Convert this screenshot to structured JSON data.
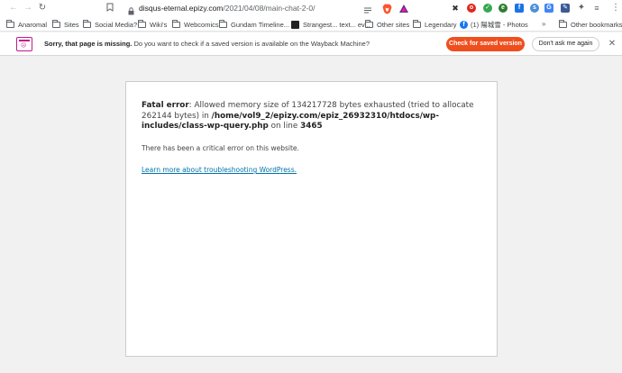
{
  "browser": {
    "url_host": "disqus-eternal.epizy.com",
    "url_path": "/2021/04/08/main-chat-2-0/",
    "icons": {
      "back": "back-arrow-icon",
      "forward": "forward-arrow-icon",
      "reload": "reload-icon",
      "bookmark": "bookmark-icon",
      "lock": "lock-icon",
      "reader": "reader-mode-icon",
      "brave": "brave-shields-icon",
      "rewards": "brave-rewards-icon",
      "menu": "kebab-menu-icon"
    }
  },
  "bookmarks": {
    "items": [
      {
        "label": "Anaromal",
        "type": "folder"
      },
      {
        "label": "Sites",
        "type": "folder"
      },
      {
        "label": "Social Media?",
        "type": "folder"
      },
      {
        "label": "Wiki's",
        "type": "folder"
      },
      {
        "label": "Webcomics",
        "type": "folder"
      },
      {
        "label": "Gundam Timeline...",
        "type": "folder"
      },
      {
        "label": "Strangest... text... ev...",
        "type": "page"
      },
      {
        "label": "Other sites",
        "type": "folder"
      },
      {
        "label": "Legendary",
        "type": "folder"
      },
      {
        "label": "(1) 陽城雪 - Photos",
        "type": "page"
      }
    ],
    "overflow": "»",
    "other": "Other bookmarks"
  },
  "infobar": {
    "title": "Sorry, that page is missing.",
    "message": "Do you want to check if a saved version is available on the Wayback Machine?",
    "check_button": "Check for saved version",
    "dont_button": "Don't ask me again",
    "close": "✕"
  },
  "error": {
    "label": "Fatal error",
    "text": ": Allowed memory size of 134217728 bytes exhausted (tried to allocate 262144 bytes) in ",
    "path": "/home/vol9_2/epizy.com/epiz_26932310/htdocs/wp-includes/class-wp-query.php",
    "on_line": " on line ",
    "line": "3465",
    "critical": "There has been a critical error on this website.",
    "link": "Learn more about troubleshooting WordPress."
  },
  "colors": {
    "accent": "#ef4f1e",
    "wayback": "#c2188e",
    "link": "#0073aa"
  }
}
